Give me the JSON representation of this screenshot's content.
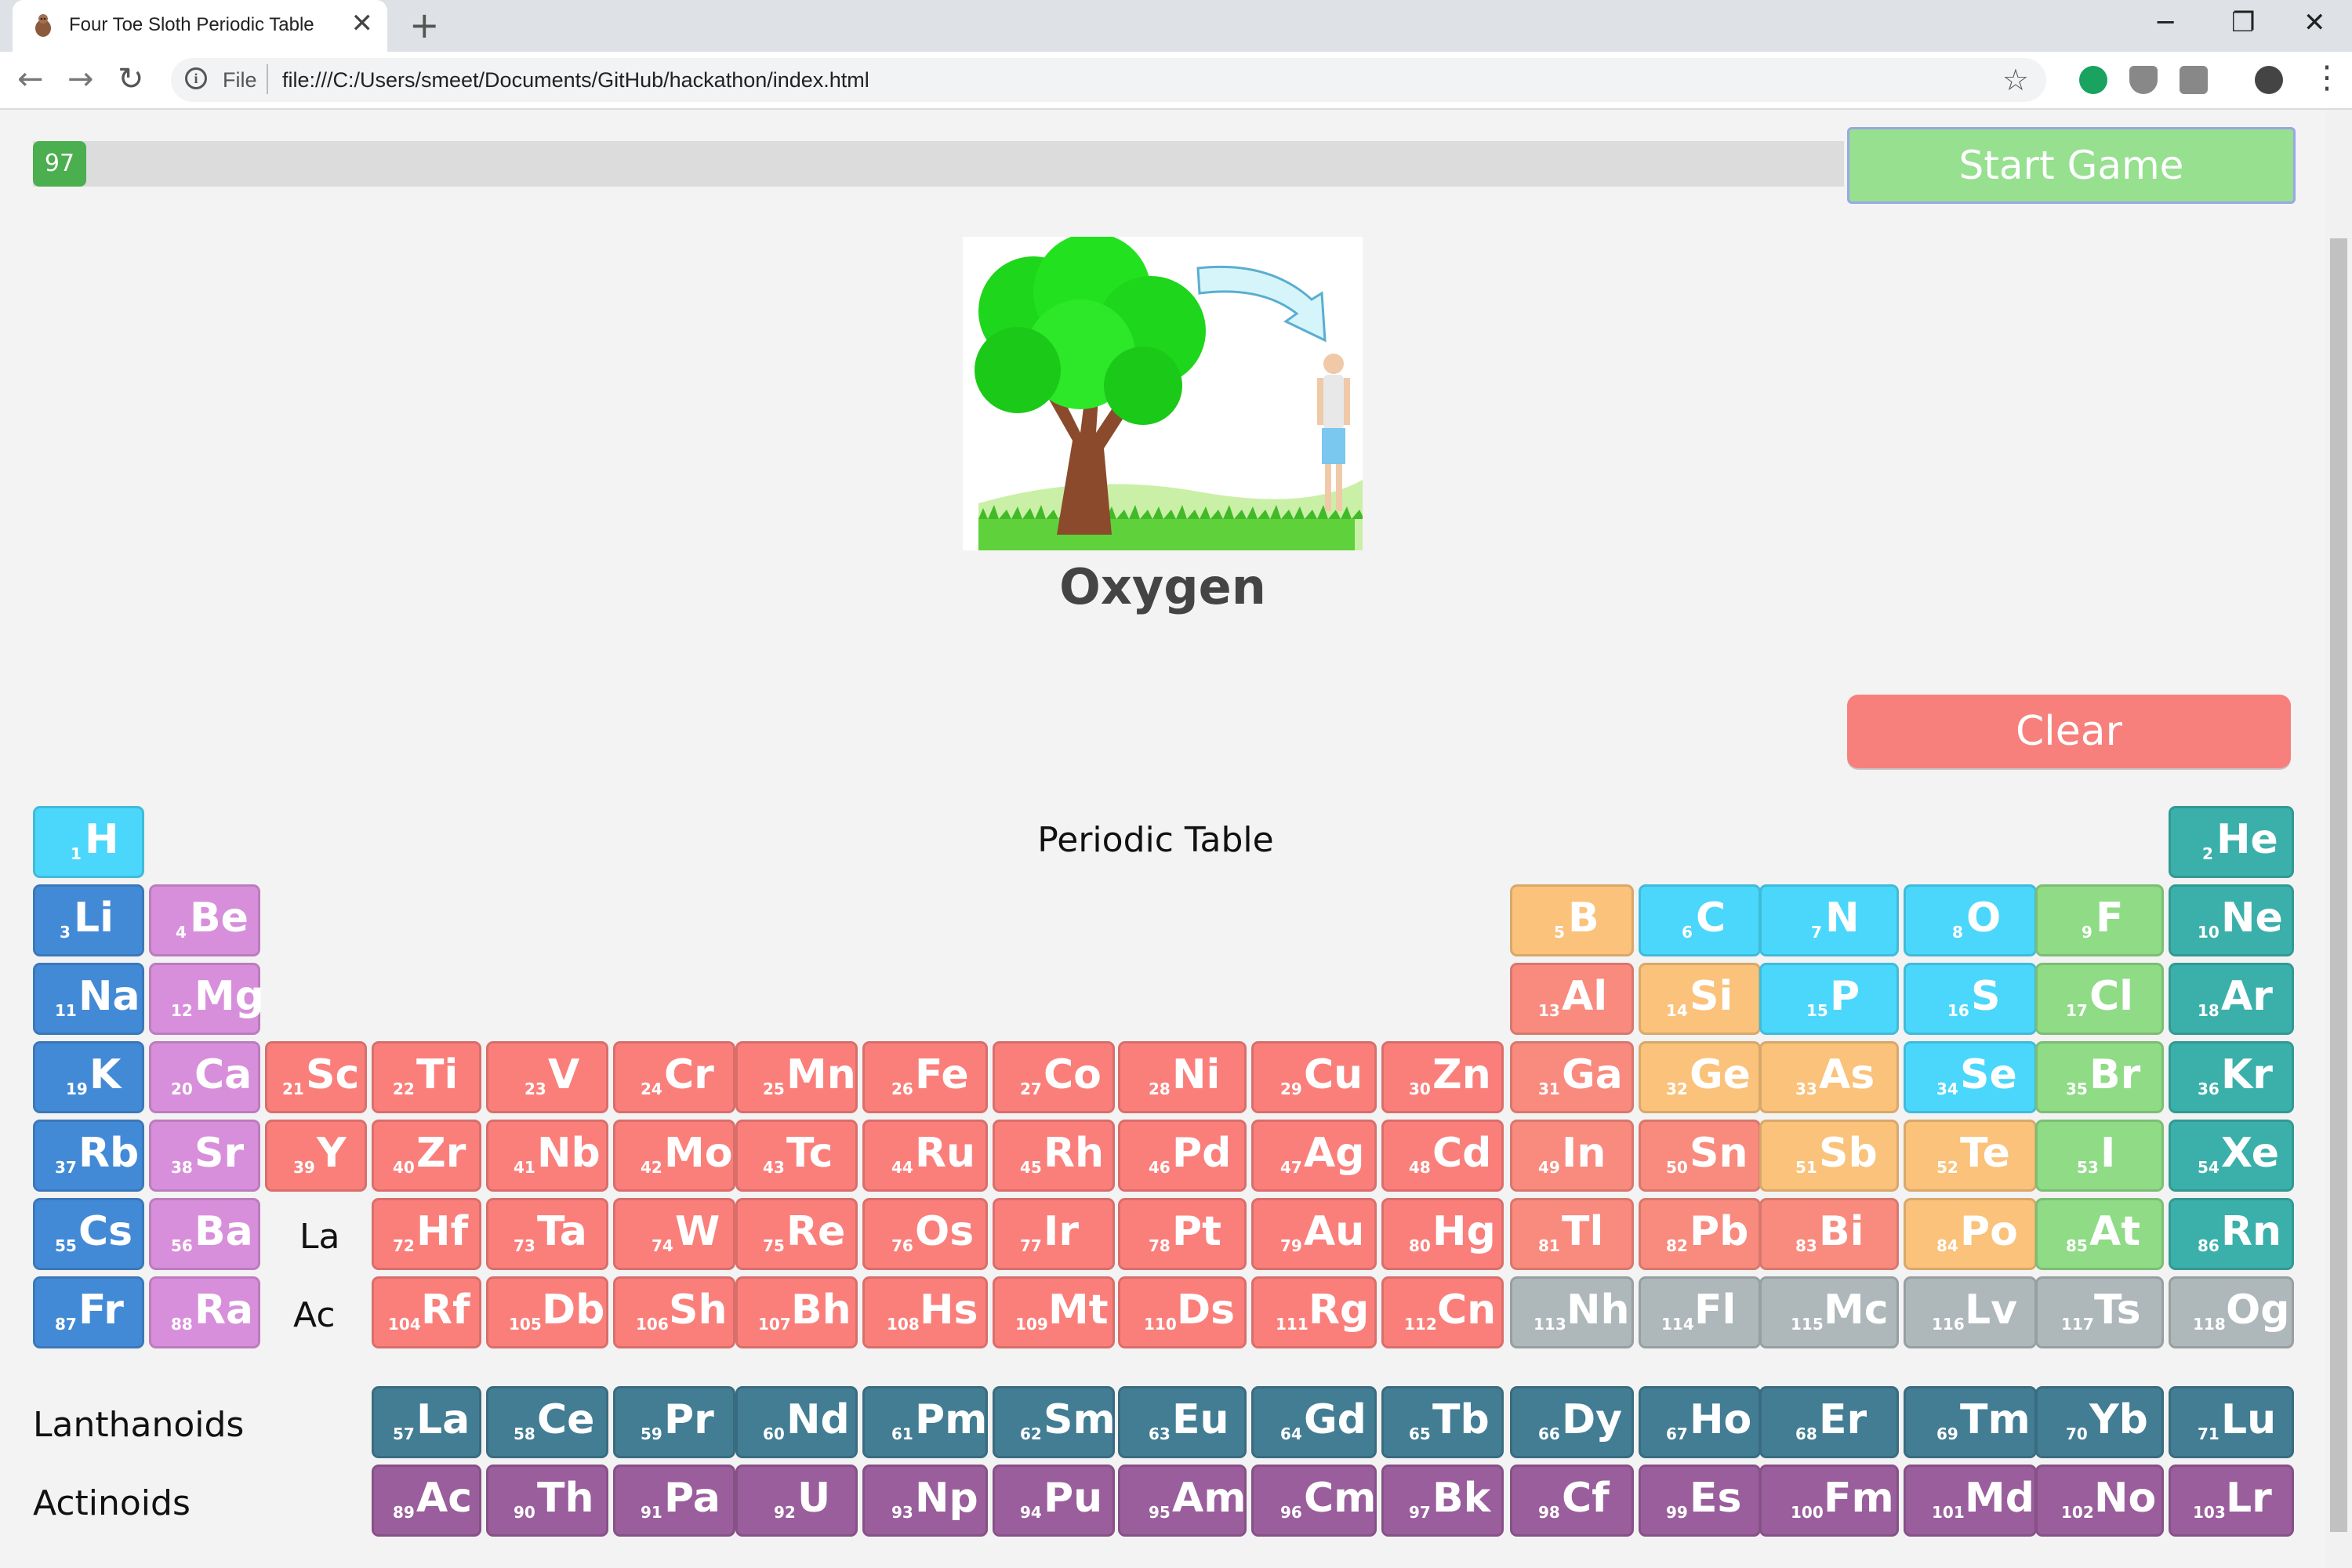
{
  "browser": {
    "tab_title": "Four Toe Sloth Periodic Table",
    "tab_close": "✕",
    "new_tab": "+",
    "url_scheme": "File",
    "url": "file:///C:/Users/smeet/Documents/GitHub/hackathon/index.html",
    "minimize": "─",
    "maximize": "❐",
    "close": "✕"
  },
  "game": {
    "progress_value": "97",
    "progress_fraction": 1.0,
    "start_label": "Start Game",
    "element_name": "Oxygen",
    "clear_label": "Clear"
  },
  "table": {
    "title": "Periodic Table",
    "la_placeholder": "La",
    "ac_placeholder": "Ac",
    "lanthanoids_label": "Lanthanoids",
    "actinoids_label": "Actinoids"
  },
  "colors": {
    "hydrogen": "#4ad7fb",
    "alkali": "#438ad6",
    "alkaline": "#d88fdb",
    "transition": "#fa7f7b",
    "post_transition": "#f98a7e",
    "metalloid": "#fac27a",
    "nonmetal": "#4ad7fb",
    "halogen": "#8fdb86",
    "noble": "#3bb0aa",
    "unknown": "#aeb7ba",
    "lanthanoid": "#427d94",
    "actinoid": "#9a5e9c",
    "start_button": "#96e08f",
    "clear_button": "#f7807c",
    "progress": "#4bae4f"
  },
  "elements": [
    {
      "n": "1",
      "s": "H",
      "c": "hydrogen"
    },
    {
      "n": "2",
      "s": "He",
      "c": "noble"
    },
    {
      "n": "3",
      "s": "Li",
      "c": "alkali"
    },
    {
      "n": "4",
      "s": "Be",
      "c": "alkaline"
    },
    {
      "n": "5",
      "s": "B",
      "c": "metalloid"
    },
    {
      "n": "6",
      "s": "C",
      "c": "nonmetal"
    },
    {
      "n": "7",
      "s": "N",
      "c": "nonmetal"
    },
    {
      "n": "8",
      "s": "O",
      "c": "nonmetal"
    },
    {
      "n": "9",
      "s": "F",
      "c": "halogen"
    },
    {
      "n": "10",
      "s": "Ne",
      "c": "noble"
    },
    {
      "n": "11",
      "s": "Na",
      "c": "alkali"
    },
    {
      "n": "12",
      "s": "Mg",
      "c": "alkaline"
    },
    {
      "n": "13",
      "s": "Al",
      "c": "post_transition"
    },
    {
      "n": "14",
      "s": "Si",
      "c": "metalloid"
    },
    {
      "n": "15",
      "s": "P",
      "c": "nonmetal"
    },
    {
      "n": "16",
      "s": "S",
      "c": "nonmetal"
    },
    {
      "n": "17",
      "s": "Cl",
      "c": "halogen"
    },
    {
      "n": "18",
      "s": "Ar",
      "c": "noble"
    },
    {
      "n": "19",
      "s": "K",
      "c": "alkali"
    },
    {
      "n": "20",
      "s": "Ca",
      "c": "alkaline"
    },
    {
      "n": "21",
      "s": "Sc",
      "c": "transition"
    },
    {
      "n": "22",
      "s": "Ti",
      "c": "transition"
    },
    {
      "n": "23",
      "s": "V",
      "c": "transition"
    },
    {
      "n": "24",
      "s": "Cr",
      "c": "transition"
    },
    {
      "n": "25",
      "s": "Mn",
      "c": "transition"
    },
    {
      "n": "26",
      "s": "Fe",
      "c": "transition"
    },
    {
      "n": "27",
      "s": "Co",
      "c": "transition"
    },
    {
      "n": "28",
      "s": "Ni",
      "c": "transition"
    },
    {
      "n": "29",
      "s": "Cu",
      "c": "transition"
    },
    {
      "n": "30",
      "s": "Zn",
      "c": "transition"
    },
    {
      "n": "31",
      "s": "Ga",
      "c": "post_transition"
    },
    {
      "n": "32",
      "s": "Ge",
      "c": "metalloid"
    },
    {
      "n": "33",
      "s": "As",
      "c": "metalloid"
    },
    {
      "n": "34",
      "s": "Se",
      "c": "nonmetal"
    },
    {
      "n": "35",
      "s": "Br",
      "c": "halogen"
    },
    {
      "n": "36",
      "s": "Kr",
      "c": "noble"
    },
    {
      "n": "37",
      "s": "Rb",
      "c": "alkali"
    },
    {
      "n": "38",
      "s": "Sr",
      "c": "alkaline"
    },
    {
      "n": "39",
      "s": "Y",
      "c": "transition"
    },
    {
      "n": "40",
      "s": "Zr",
      "c": "transition"
    },
    {
      "n": "41",
      "s": "Nb",
      "c": "transition"
    },
    {
      "n": "42",
      "s": "Mo",
      "c": "transition"
    },
    {
      "n": "43",
      "s": "Tc",
      "c": "transition"
    },
    {
      "n": "44",
      "s": "Ru",
      "c": "transition"
    },
    {
      "n": "45",
      "s": "Rh",
      "c": "transition"
    },
    {
      "n": "46",
      "s": "Pd",
      "c": "transition"
    },
    {
      "n": "47",
      "s": "Ag",
      "c": "transition"
    },
    {
      "n": "48",
      "s": "Cd",
      "c": "transition"
    },
    {
      "n": "49",
      "s": "In",
      "c": "post_transition"
    },
    {
      "n": "50",
      "s": "Sn",
      "c": "post_transition"
    },
    {
      "n": "51",
      "s": "Sb",
      "c": "metalloid"
    },
    {
      "n": "52",
      "s": "Te",
      "c": "metalloid"
    },
    {
      "n": "53",
      "s": "I",
      "c": "halogen"
    },
    {
      "n": "54",
      "s": "Xe",
      "c": "noble"
    },
    {
      "n": "55",
      "s": "Cs",
      "c": "alkali"
    },
    {
      "n": "56",
      "s": "Ba",
      "c": "alkaline"
    },
    {
      "n": "72",
      "s": "Hf",
      "c": "transition"
    },
    {
      "n": "73",
      "s": "Ta",
      "c": "transition"
    },
    {
      "n": "74",
      "s": "W",
      "c": "transition"
    },
    {
      "n": "75",
      "s": "Re",
      "c": "transition"
    },
    {
      "n": "76",
      "s": "Os",
      "c": "transition"
    },
    {
      "n": "77",
      "s": "Ir",
      "c": "transition"
    },
    {
      "n": "78",
      "s": "Pt",
      "c": "transition"
    },
    {
      "n": "79",
      "s": "Au",
      "c": "transition"
    },
    {
      "n": "80",
      "s": "Hg",
      "c": "transition"
    },
    {
      "n": "81",
      "s": "Tl",
      "c": "post_transition"
    },
    {
      "n": "82",
      "s": "Pb",
      "c": "post_transition"
    },
    {
      "n": "83",
      "s": "Bi",
      "c": "post_transition"
    },
    {
      "n": "84",
      "s": "Po",
      "c": "metalloid"
    },
    {
      "n": "85",
      "s": "At",
      "c": "halogen"
    },
    {
      "n": "86",
      "s": "Rn",
      "c": "noble"
    },
    {
      "n": "87",
      "s": "Fr",
      "c": "alkali"
    },
    {
      "n": "88",
      "s": "Ra",
      "c": "alkaline"
    },
    {
      "n": "104",
      "s": "Rf",
      "c": "transition"
    },
    {
      "n": "105",
      "s": "Db",
      "c": "transition"
    },
    {
      "n": "106",
      "s": "Sh",
      "c": "transition"
    },
    {
      "n": "107",
      "s": "Bh",
      "c": "transition"
    },
    {
      "n": "108",
      "s": "Hs",
      "c": "transition"
    },
    {
      "n": "109",
      "s": "Mt",
      "c": "transition"
    },
    {
      "n": "110",
      "s": "Ds",
      "c": "transition"
    },
    {
      "n": "111",
      "s": "Rg",
      "c": "transition"
    },
    {
      "n": "112",
      "s": "Cn",
      "c": "transition"
    },
    {
      "n": "113",
      "s": "Nh",
      "c": "unknown"
    },
    {
      "n": "114",
      "s": "Fl",
      "c": "unknown"
    },
    {
      "n": "115",
      "s": "Mc",
      "c": "unknown"
    },
    {
      "n": "116",
      "s": "Lv",
      "c": "unknown"
    },
    {
      "n": "117",
      "s": "Ts",
      "c": "unknown"
    },
    {
      "n": "118",
      "s": "Og",
      "c": "unknown"
    },
    {
      "n": "57",
      "s": "La",
      "c": "lanthanoid"
    },
    {
      "n": "58",
      "s": "Ce",
      "c": "lanthanoid"
    },
    {
      "n": "59",
      "s": "Pr",
      "c": "lanthanoid"
    },
    {
      "n": "60",
      "s": "Nd",
      "c": "lanthanoid"
    },
    {
      "n": "61",
      "s": "Pm",
      "c": "lanthanoid"
    },
    {
      "n": "62",
      "s": "Sm",
      "c": "lanthanoid"
    },
    {
      "n": "63",
      "s": "Eu",
      "c": "lanthanoid"
    },
    {
      "n": "64",
      "s": "Gd",
      "c": "lanthanoid"
    },
    {
      "n": "65",
      "s": "Tb",
      "c": "lanthanoid"
    },
    {
      "n": "66",
      "s": "Dy",
      "c": "lanthanoid"
    },
    {
      "n": "67",
      "s": "Ho",
      "c": "lanthanoid"
    },
    {
      "n": "68",
      "s": "Er",
      "c": "lanthanoid"
    },
    {
      "n": "69",
      "s": "Tm",
      "c": "lanthanoid"
    },
    {
      "n": "70",
      "s": "Yb",
      "c": "lanthanoid"
    },
    {
      "n": "71",
      "s": "Lu",
      "c": "lanthanoid"
    },
    {
      "n": "89",
      "s": "Ac",
      "c": "actinoid"
    },
    {
      "n": "90",
      "s": "Th",
      "c": "actinoid"
    },
    {
      "n": "91",
      "s": "Pa",
      "c": "actinoid"
    },
    {
      "n": "92",
      "s": "U",
      "c": "actinoid"
    },
    {
      "n": "93",
      "s": "Np",
      "c": "actinoid"
    },
    {
      "n": "94",
      "s": "Pu",
      "c": "actinoid"
    },
    {
      "n": "95",
      "s": "Am",
      "c": "actinoid"
    },
    {
      "n": "96",
      "s": "Cm",
      "c": "actinoid"
    },
    {
      "n": "97",
      "s": "Bk",
      "c": "actinoid"
    },
    {
      "n": "98",
      "s": "Cf",
      "c": "actinoid"
    },
    {
      "n": "99",
      "s": "Es",
      "c": "actinoid"
    },
    {
      "n": "100",
      "s": "Fm",
      "c": "actinoid"
    },
    {
      "n": "101",
      "s": "Md",
      "c": "actinoid"
    },
    {
      "n": "102",
      "s": "No",
      "c": "actinoid"
    },
    {
      "n": "103",
      "s": "Lr",
      "c": "actinoid"
    }
  ]
}
